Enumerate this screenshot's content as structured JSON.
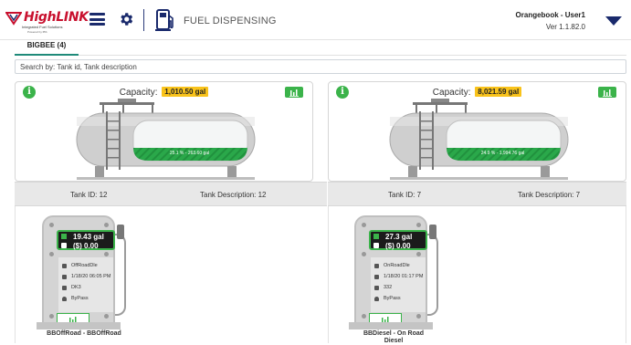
{
  "header": {
    "logo_text": "HighLINK",
    "logo_sub": "Integrated Fuel Solutions",
    "logo_sub2": "Powered by IBS",
    "app_title": "FUEL DISPENSING",
    "user": "Orangebook - User1",
    "version": "Ver 1.1.82.0"
  },
  "tabs": [
    {
      "label": "BIGBEE (4)"
    }
  ],
  "search": {
    "placeholder": "Search by: Tank id, Tank description",
    "value": ""
  },
  "tanks": [
    {
      "capacity_label": "Capacity:",
      "capacity": "1,010.50 gal",
      "fill_text": "25.1 % - 263.60 gal",
      "fill_percent": 25.1,
      "tank_id": "Tank ID: 12",
      "tank_description": "Tank Description: 12"
    },
    {
      "capacity_label": "Capacity:",
      "capacity": "8,021.59 gal",
      "fill_text": "24.9 % - 1,994.76 gal",
      "fill_percent": 24.9,
      "tank_id": "Tank ID: 7",
      "tank_description": "Tank Description: 7"
    }
  ],
  "pumps": [
    {
      "gallons": "19.43 gal",
      "amount": "($) 0.00",
      "fuel": "OffRoadDle",
      "datetime": "1/18/20 06:05 PM",
      "vehicle": "DK3",
      "driver": "ByPass",
      "name": "BBOffRoad - BBOffRoad"
    },
    {
      "gallons": "27.3 gal",
      "amount": "($) 0.00",
      "fuel": "OnRoadDle",
      "datetime": "1/18/20 01:17 PM",
      "vehicle": "332",
      "driver": "ByPass",
      "name_line1": "BBDiesel - On Road",
      "name_line2": "Diesel"
    }
  ],
  "colors": {
    "accent_green": "#3bb34a",
    "badge_yellow": "#f9c31b",
    "brand_red": "#c8102e",
    "navy": "#1a2a6c",
    "tab_underline": "#1f8a7a"
  },
  "icons": [
    "logo-icon",
    "menu-icon",
    "gear-icon",
    "fuel-pump-icon",
    "caret-down-icon",
    "info-icon",
    "bar-chart-icon"
  ]
}
